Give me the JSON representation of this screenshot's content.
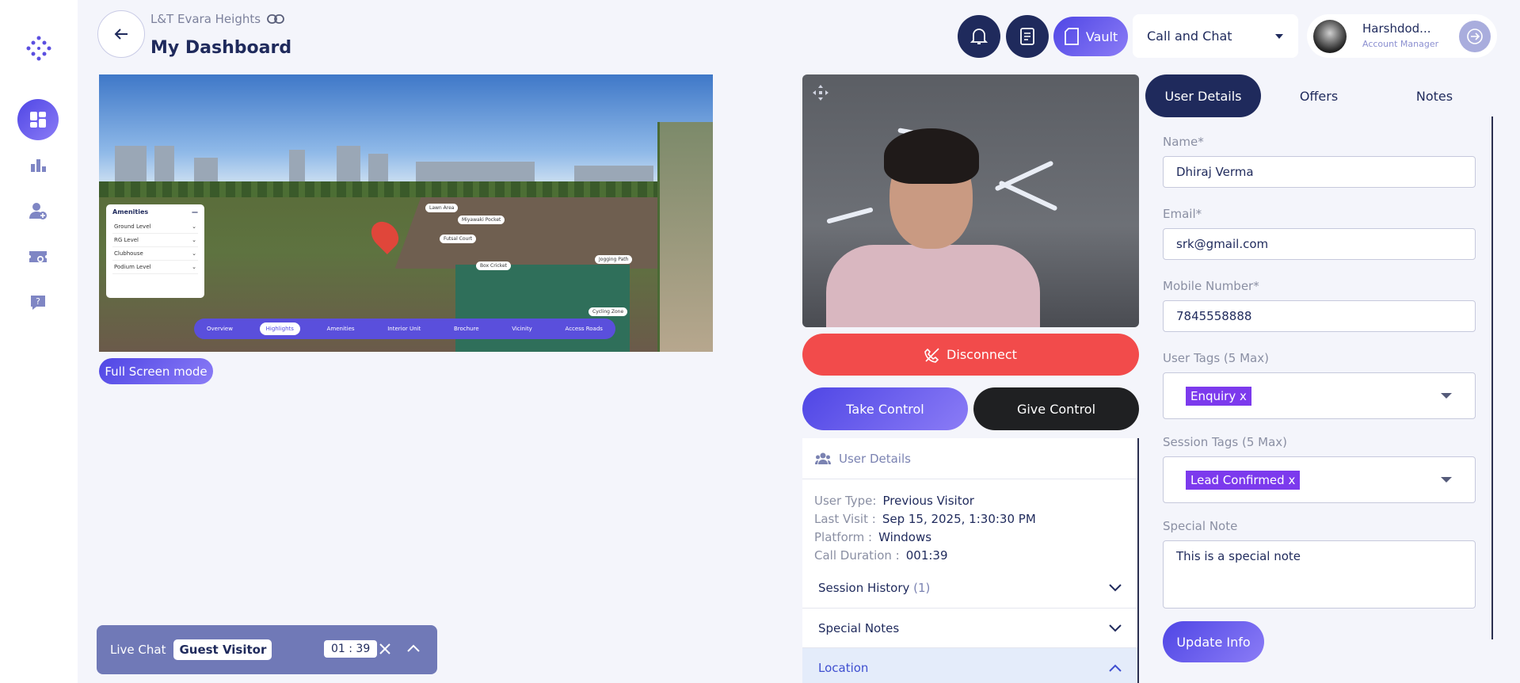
{
  "header": {
    "project_name": "L&T Evara Heights",
    "title": "My Dashboard",
    "vault_label": "Vault",
    "mode_select": "Call and Chat",
    "user_name": "Harshdod...",
    "user_role": "Account Manager"
  },
  "sidebar": {
    "items": [
      {
        "icon": "dashboard-icon",
        "active": true
      },
      {
        "icon": "chart-icon"
      },
      {
        "icon": "add-user-icon"
      },
      {
        "icon": "ticket-icon"
      },
      {
        "icon": "help-icon"
      }
    ]
  },
  "viewer": {
    "amenities_title": "Amenities",
    "amenity_items": [
      "Ground Level",
      "RG Level",
      "Clubhouse",
      "Podium Level"
    ],
    "map_labels": [
      "Lawn Area",
      "Miyawaki Pocket",
      "Futsal Court",
      "Box Cricket",
      "Jogging Path",
      "Cycling Zone"
    ],
    "tour_tabs": [
      "Overview",
      "Highlights",
      "Amenities",
      "Interior Unit",
      "Brochure",
      "Vicinity",
      "Access Roads"
    ],
    "active_tab": "Highlights",
    "fullscreen_label": "Full Screen mode"
  },
  "chat": {
    "label": "Live Chat",
    "visitor": "Guest Visitor",
    "timer": "01 : 39"
  },
  "call": {
    "disconnect_label": "Disconnect",
    "take_control_label": "Take Control",
    "give_control_label": "Give Control"
  },
  "user_details": {
    "header": "User Details",
    "user_type_label": "User Type:",
    "user_type": "Previous Visitor",
    "last_visit_label": "Last Visit :",
    "last_visit": "Sep 15, 2025, 1:30:30 PM",
    "platform_label": "Platform :",
    "platform": "Windows",
    "call_duration_label": "Call Duration :",
    "call_duration": "001:39",
    "accordions": [
      "Session History",
      "Special Notes",
      "Location"
    ],
    "session_history_count": "(1)"
  },
  "right_panel": {
    "tabs": [
      "User Details",
      "Offers",
      "Notes"
    ],
    "name_label": "Name*",
    "name_value": "Dhiraj Verma",
    "email_label": "Email*",
    "email_value": "srk@gmail.com",
    "mobile_label": "Mobile Number*",
    "mobile_value": "7845558888",
    "user_tags_label": "User Tags (5 Max)",
    "user_tag": "Enquiry",
    "session_tags_label": "Session Tags (5 Max)",
    "session_tag": "Lead Confirmed",
    "special_note_label": "Special Note",
    "special_note_value": "This is a special note",
    "update_label": "Update Info"
  },
  "colors": {
    "primary": "#4f46e5",
    "navy": "#1f2a5c",
    "danger": "#f24b4b",
    "tag": "#7c3aed"
  }
}
